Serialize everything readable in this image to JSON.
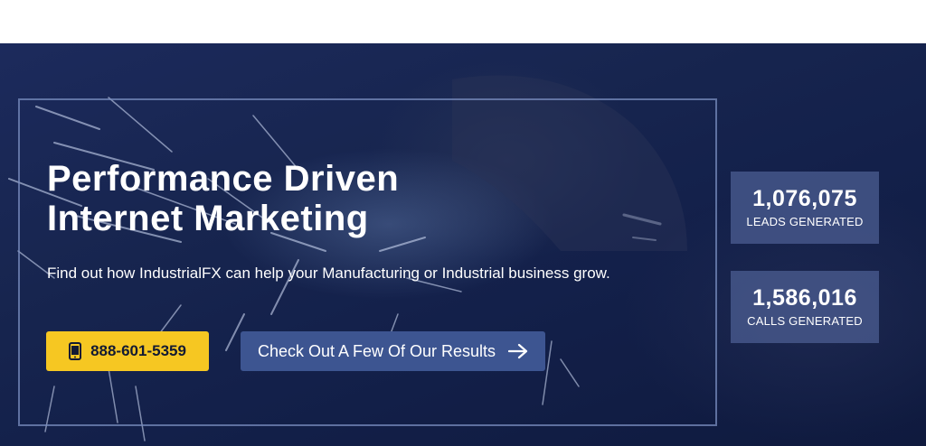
{
  "hero": {
    "headline_line1": "Performance Driven",
    "headline_line2": "Internet Marketing",
    "subtext": "Find out how IndustrialFX can help your Manufacturing or Industrial business grow.",
    "phone_button": {
      "label": "888-601-5359",
      "icon": "mobile-phone-icon"
    },
    "results_button": {
      "label": "Check Out A Few Of Our Results",
      "icon": "arrow-right-icon"
    }
  },
  "stats": [
    {
      "value": "1,076,075",
      "label": "LEADS GENERATED"
    },
    {
      "value": "1,586,016",
      "label": "CALLS GENERATED"
    }
  ],
  "colors": {
    "hero_background": "#17254f",
    "frame_border": "#7a8cbe",
    "phone_button": "#f6c722",
    "results_button": "#3d5591",
    "stat_box": "#4e6094"
  }
}
